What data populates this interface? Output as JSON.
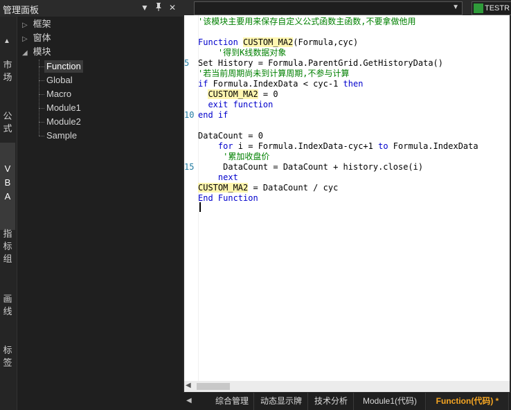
{
  "panel": {
    "title": "管理面板",
    "dropdown_glyph": "▼",
    "pin_glyph": "📌",
    "close_glyph": "✕"
  },
  "left_tabs": [
    {
      "label": "市场"
    },
    {
      "label": "公式"
    },
    {
      "label": "VBA"
    },
    {
      "label": "指标组"
    },
    {
      "label": "画线"
    },
    {
      "label": "标签"
    }
  ],
  "tree": {
    "nodes": [
      "框架",
      "窗体",
      "模块"
    ],
    "leaves": [
      "Function",
      "Global",
      "Macro",
      "Module1",
      "Module2",
      "Sample"
    ]
  },
  "toolbar": {
    "combo_value": "",
    "testr_label": "TESTR"
  },
  "code": {
    "line_numbers": [
      "5",
      "10",
      "15"
    ],
    "lines": {
      "l1": "'该模块主要用来保存自定义公式函数主函数,不要拿做他用",
      "l3a": "Function ",
      "l3b": "CUSTOM_MA2",
      "l3c": "(Formula,cyc)",
      "l4": "    '得到K线数据对象",
      "l5": "Set History = Formula.ParentGrid.GetHistoryData()",
      "l6": "'若当前周期尚未到计算周期,不参与计算",
      "l7a": "if",
      "l7b": " Formula.IndexData < cyc-1 ",
      "l7c": "then",
      "l8a": "  ",
      "l8b": "CUSTOM_MA2",
      "l8c": " = 0",
      "l9a": "  exit function",
      "l10": "end if",
      "l12": "DataCount = 0",
      "l13a": "    for",
      "l13b": " i = Formula.IndexData-cyc+1 ",
      "l13c": "to",
      "l13d": " Formula.IndexData",
      "l14": "     '累加收盘价",
      "l15": "     DataCount = DataCount + history.close(i)",
      "l16": "    next",
      "l17a": "CUSTOM_MA2",
      "l17b": " = DataCount / cyc",
      "l18": "End Function"
    }
  },
  "bottom_tabs": [
    {
      "label": "综合管理"
    },
    {
      "label": "动态显示牌"
    },
    {
      "label": "技术分析"
    },
    {
      "label": "Module1(代码)"
    },
    {
      "label": "Function(代码) *"
    }
  ],
  "colors": {
    "keyword": "#0000cc",
    "comment": "#008000",
    "active_tab": "#f6a623",
    "highlight": "#fff6b0"
  }
}
